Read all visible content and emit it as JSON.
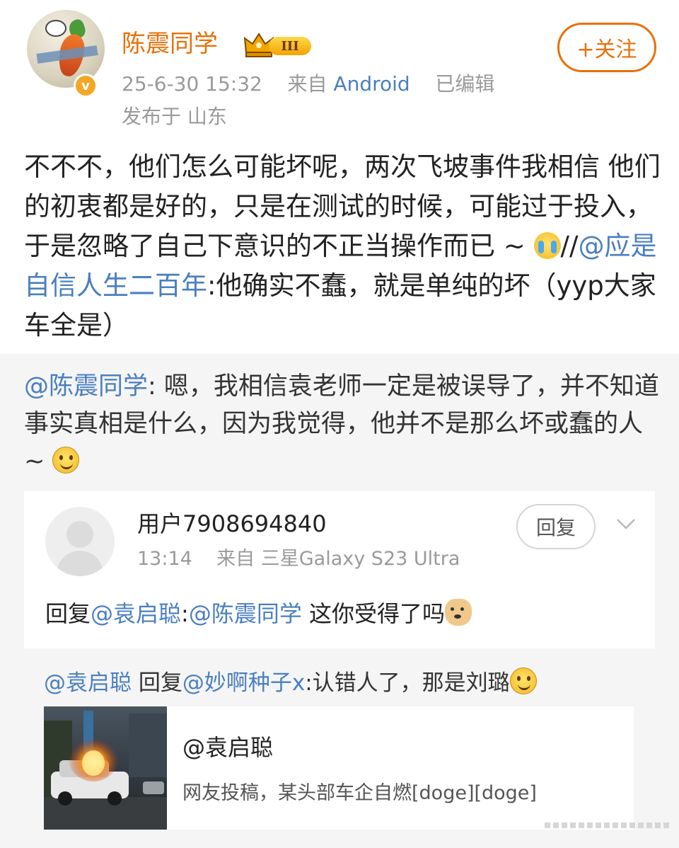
{
  "header": {
    "username": "陈震同学",
    "level_badge": "III",
    "timestamp": "25-6-30 15:32",
    "source_prefix": "来自",
    "source_device": "Android",
    "edited": "已编辑",
    "location": "发布于 山东",
    "follow_label": "+关注"
  },
  "post": {
    "text_before_emoji": "不不不，他们怎么可能坏呢，两次飞坡事件我相信 他们的初衷都是好的，只是在测试的时候，可能过于投入，于是忽略了自己下意识的不正当操作而已 ~ ",
    "emoji": "crying-laughing",
    "separator": "//",
    "mention": "@应是自信人生二百年",
    "text_after_mention": ":他确实不蠢，就是单纯的坏（yyp大家车全是）"
  },
  "repost": {
    "mention": "@陈震同学",
    "text": ": 嗯，我相信袁老师一定是被误导了，并不知道事实真相是什么，因为我觉得，他并不是那么坏或蠢的人 ~ ",
    "emoji": "smile"
  },
  "comment": {
    "username": "用户7908694840",
    "time": "13:14",
    "source": "来自 三星Galaxy S23 Ultra",
    "reply_label": "回复",
    "text_prefix": "回复",
    "mention_1": "@袁启聪",
    "colon": ":",
    "mention_2": "@陈震同学",
    "text_suffix": " 这你受得了吗",
    "emoji": "doge"
  },
  "sub_reply": {
    "mention_1": "@袁启聪",
    "middle": " 回复",
    "mention_2": "@妙啊种子x",
    "text": ":认错人了，那是刘璐",
    "emoji": "smile"
  },
  "link_card": {
    "title": "@袁启聪",
    "description": "网友投稿，某头部车企自燃[doge][doge]"
  },
  "colors": {
    "username": "#e8710a",
    "link": "#4a7fbf",
    "follow": "#e8710a",
    "background_grey": "#f5f5f5"
  }
}
